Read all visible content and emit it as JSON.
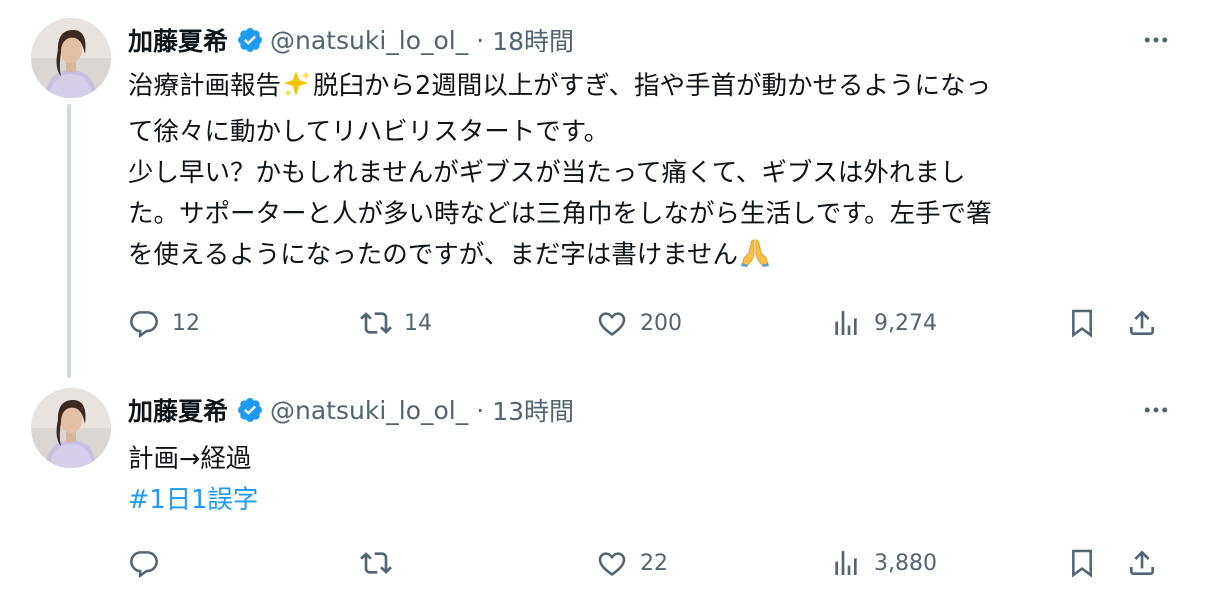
{
  "tweets": [
    {
      "display_name": "加藤夏希",
      "handle": "@natsuki_lo_ol_",
      "separator": "·",
      "time": "18時間",
      "text": {
        "line1_a": "治療計画報告",
        "line1_b": "脱臼から2週間以上がすぎ、指や手首が動かせるようになっ",
        "line2": "て徐々に動かしてリハビリスタートです。",
        "line3": "少し早い？かもしれませんがギブスが当たって痛くて、ギブスは外れまし",
        "line4": "た。サポーターと人が多い時などは三角巾をしながら生活しです。左手で箸",
        "line5": "を使えるようになったのですが、まだ字は書けません"
      },
      "emojis": [
        "sparkles-emoji",
        "folded-hands-emoji"
      ],
      "stats": {
        "replies": "12",
        "reposts": "14",
        "likes": "200",
        "views": "9,274"
      }
    },
    {
      "display_name": "加藤夏希",
      "handle": "@natsuki_lo_ol_",
      "separator": "·",
      "time": "13時間",
      "text": {
        "line1": "計画→経過",
        "hashtag": "#1日1誤字"
      },
      "stats": {
        "replies": "",
        "reposts": "",
        "likes": "22",
        "views": "3,880"
      }
    }
  ],
  "icons": [
    "avatar",
    "verified-badge-icon",
    "more-icon",
    "reply-icon",
    "repost-icon",
    "like-icon",
    "views-icon",
    "bookmark-icon",
    "share-icon"
  ],
  "colors": {
    "text": "#0f1419",
    "secondary": "#536471",
    "accent": "#1d9bf0",
    "thread_line": "#cfd9de",
    "background": "#ffffff"
  }
}
